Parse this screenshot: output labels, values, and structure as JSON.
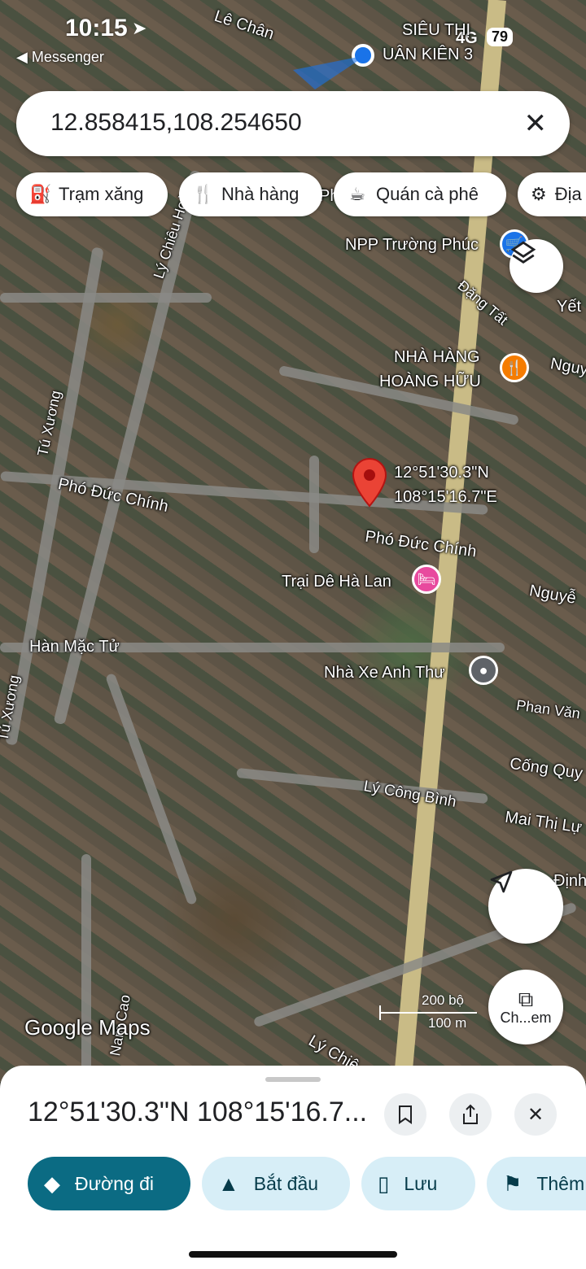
{
  "status_bar": {
    "time": "10:15",
    "back_label": "◀ Messenger",
    "network": "4G",
    "battery": "79"
  },
  "search": {
    "value": "12.858415,108.254650",
    "clear_icon": "close-icon"
  },
  "chips": [
    {
      "label": "Trạm xăng",
      "icon": "gas-station-icon"
    },
    {
      "label": "Nhà hàng",
      "icon": "restaurant-icon"
    },
    {
      "label": "Quán cà phê",
      "icon": "coffee-icon"
    },
    {
      "label": "Địa",
      "icon": "attraction-icon"
    }
  ],
  "map": {
    "pin_label": {
      "lat": "12°51'30.3\"N",
      "lng": "108°15'16.7\"E"
    },
    "streets": {
      "le_chan": "Lê Chân",
      "ly_chieu_hoang": "Lý Chiêu Hoàng",
      "tu_xuong": "Tú Xương",
      "pho_duc_chinh_left": "Phó Đức Chính",
      "pho_duc_chinh_right": "Phó Đức Chính",
      "dang_tat": "Đặng Tất",
      "yet": "Yết",
      "nguy": "Nguy",
      "nguye": "Nguyễ",
      "han_mac_tu": "Hàn Mặc Tử",
      "phan_van": "Phan Văn",
      "cong_quy": "Cống Quy",
      "ly_cong_binh": "Lý Công Bình",
      "mai_thi_lu": "Mai Thị Lự",
      "dinh": "Định",
      "nam_cao": "Nam Cao",
      "ly_chie": "Lý Chiê",
      "tu_xuong_2": "Tú Xương",
      "ph": "Ph"
    },
    "places": {
      "sieu_thi": "SIÊU THỊ",
      "quan_kien": "UÂN KIÊN 3",
      "npp": "NPP Trường Phúc",
      "nha_hang_1": "NHÀ HÀNG",
      "nha_hang_2": "HOÀNG HỮU",
      "trai_de": "Trại Dê Hà Lan",
      "nha_xe": "Nhà Xe Anh Thư"
    },
    "watermark": "Google Maps",
    "scale": {
      "top": "200 bộ",
      "bottom": "100 m"
    },
    "camera_label": "Ch...em"
  },
  "sheet": {
    "title": "12°51'30.3\"N 108°15'16.7...",
    "actions": [
      {
        "label": "Đường đi",
        "icon": "directions-icon"
      },
      {
        "label": "Bắt đầu",
        "icon": "navigation-icon"
      },
      {
        "label": "Lưu",
        "icon": "bookmark-icon"
      },
      {
        "label": "Thêm",
        "icon": "flag-icon"
      }
    ]
  },
  "colors": {
    "primary": "#0b6b83",
    "secondary_bg": "#d7eef7",
    "pin": "#ea4335"
  }
}
